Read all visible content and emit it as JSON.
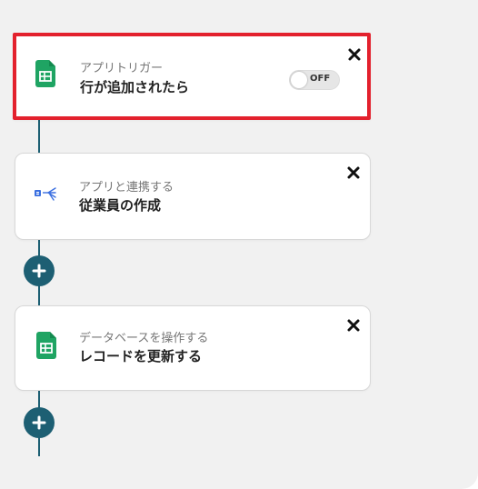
{
  "steps": [
    {
      "subtitle": "アプリトリガー",
      "title": "行が追加されたら",
      "icon": "google-sheets-icon",
      "toggle": "OFF"
    },
    {
      "subtitle": "アプリと連携する",
      "title": "従業員の作成",
      "icon": "app-connector-icon"
    },
    {
      "subtitle": "データベースを操作する",
      "title": "レコードを更新する",
      "icon": "google-sheets-icon"
    }
  ],
  "colors": {
    "selected_border": "#e3212d",
    "connector": "#1d5f73",
    "sheets_green": "#1fa463",
    "canvas_bg": "#f1f1f1"
  }
}
